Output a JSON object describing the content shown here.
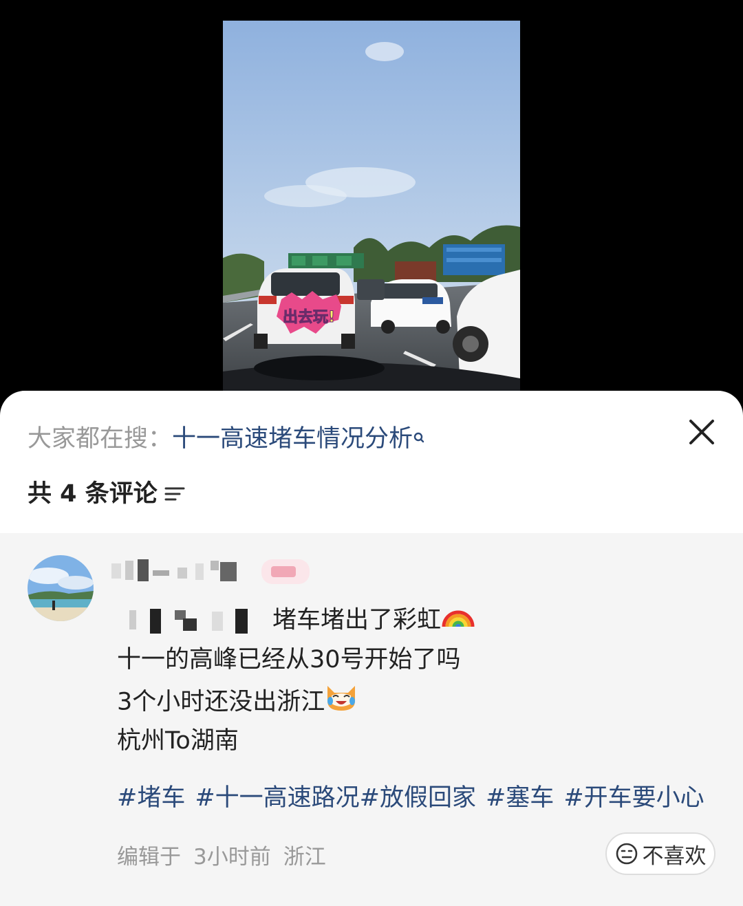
{
  "sheet": {
    "search_hint": {
      "prefix": "大家都在搜：",
      "query": "十一高速堵车情况分析",
      "icon": "search-icon"
    },
    "close_icon": "close-icon",
    "comment_count_label": "共 4 条评论",
    "sort_icon": "sort-icon"
  },
  "photo": {
    "sticker_text": "出去玩!"
  },
  "comment": {
    "body_line1_text": "堵车堵出了彩虹",
    "body_line1_emoji": "rainbow-emoji",
    "body_line2": "十一的高峰已经从30号开始了吗",
    "body_line3_text": "3个小时还没出浙江",
    "body_line3_emoji": "laughing-cat-emoji",
    "body_line4": "杭州To湖南",
    "tags": [
      "#堵车",
      "#十一高速路况#放假回家",
      "#塞车",
      "#开车要小心"
    ],
    "meta": {
      "edited": "编辑于",
      "time": "3小时前",
      "location": "浙江"
    },
    "dislike_label": "不喜欢"
  },
  "colors": {
    "link": "#2b4a7a",
    "muted": "#999999",
    "comment_bg": "#f5f5f5"
  }
}
